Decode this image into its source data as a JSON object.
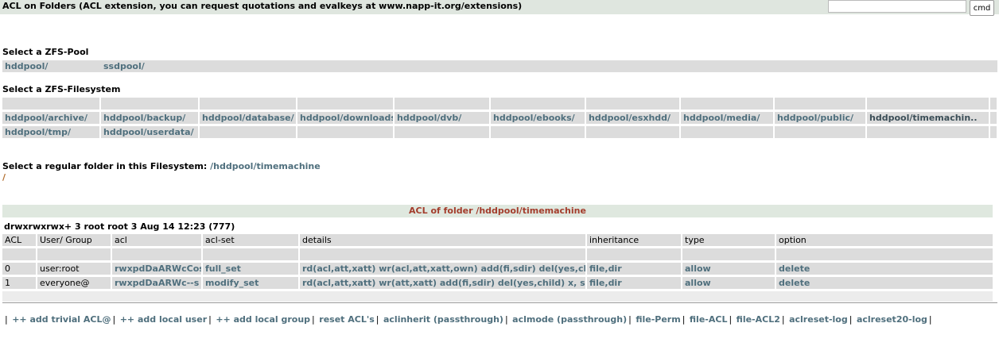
{
  "header": {
    "title": "ACL on Folders (ACL extension, you can request quotations and evalkeys at www.napp-it.org/extensions)",
    "cmd_value": "",
    "cmd_button": "cmd"
  },
  "pools": {
    "heading": "Select a ZFS-Pool",
    "items": [
      "hddpool/",
      "ssdpool/"
    ]
  },
  "filesystems": {
    "heading": "Select a ZFS-Filesystem",
    "row1": [
      "hddpool/archive/",
      "hddpool/backup/",
      "hddpool/database/",
      "hddpool/downloads/",
      "hddpool/dvb/",
      "hddpool/ebooks/",
      "hddpool/esxhdd/",
      "hddpool/media/",
      "hddpool/public/",
      "hddpool/timemachin.."
    ],
    "row2": [
      "hddpool/tmp/",
      "hddpool/userdata/"
    ]
  },
  "folder": {
    "label": "Select a regular folder in this Filesystem:",
    "path": "/hddpool/timemachine",
    "current": "/"
  },
  "acl": {
    "heading": "ACL of folder /hddpool/timemachine",
    "perms": "drwxrwxrwx+ 3 root root 3 Aug 14 12:23 (777)",
    "columns": [
      "ACL",
      "User/ Group",
      "acl",
      "acl-set",
      "details",
      "inheritance",
      "type",
      "option"
    ],
    "rows": [
      [
        "0",
        "user:root",
        "rwxpdDaARWcCos",
        "full_set",
        "rd(acl,att,xatt) wr(acl,att,xatt,own) add(fi,sdir) del(yes,child) x, s",
        "file,dir",
        "allow",
        "delete"
      ],
      [
        "1",
        "everyone@",
        "rwxpdDaARWc--s",
        "modify_set",
        "rd(acl,att,xatt) wr(att,xatt) add(fi,sdir) del(yes,child) x, s",
        "file,dir",
        "allow",
        "delete"
      ]
    ]
  },
  "actions": [
    "++ add trivial ACL@",
    "++ add local user",
    "++ add local group",
    "reset ACL's",
    "aclinherit (passthrough)",
    "aclmode (passthrough)",
    "file-Perm",
    "file-ACL",
    "file-ACL2",
    "aclreset-log",
    "aclreset20-log"
  ]
}
